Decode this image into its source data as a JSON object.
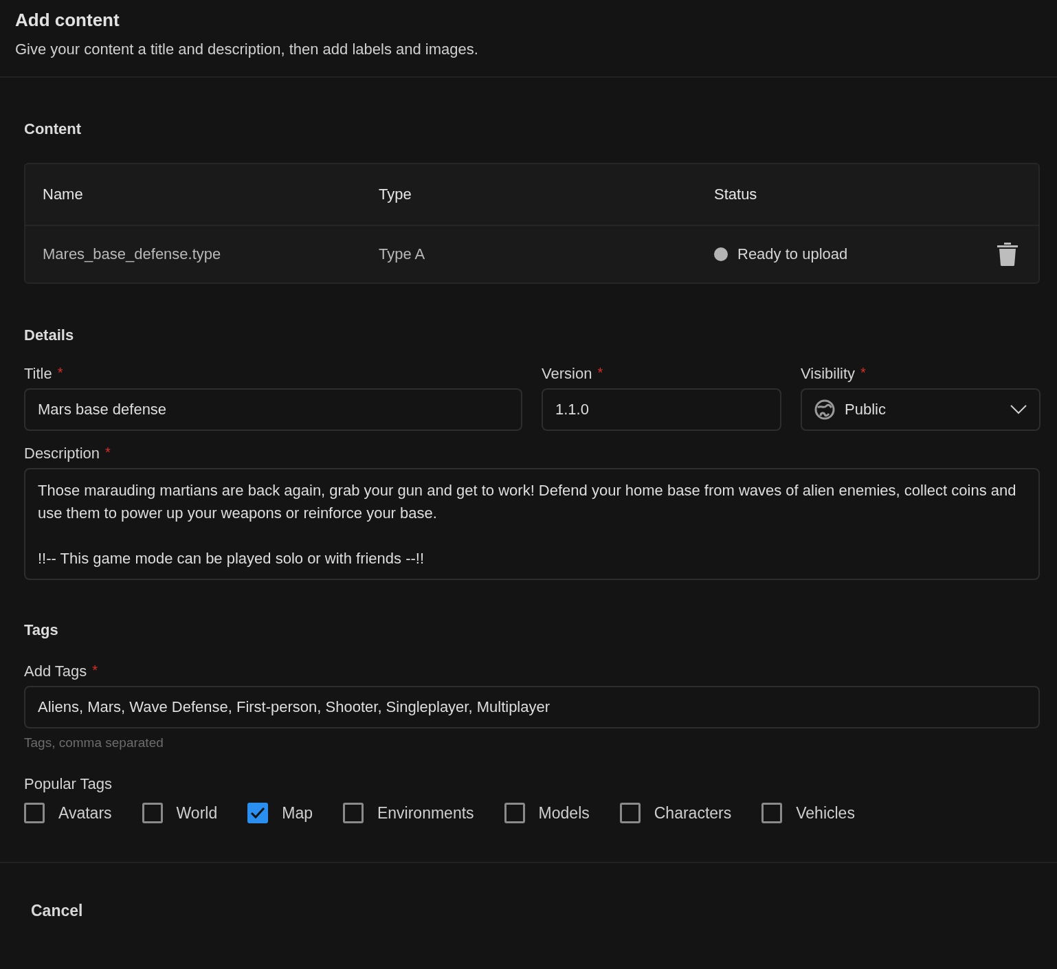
{
  "header": {
    "title": "Add content",
    "subtitle": "Give your content a title and description, then add labels and images."
  },
  "content": {
    "heading": "Content",
    "table": {
      "columns": [
        "Name",
        "Type",
        "Status"
      ],
      "rows": [
        {
          "name": "Mares_base_defense.type",
          "type": "Type A",
          "status": "Ready to upload"
        }
      ]
    }
  },
  "details": {
    "heading": "Details",
    "title_field": {
      "label": "Title",
      "required_mark": "*",
      "value": "Mars base defense"
    },
    "version_field": {
      "label": "Version",
      "required_mark": "*",
      "value": "1.1.0"
    },
    "visibility_field": {
      "label": "Visibility",
      "required_mark": "*",
      "value": "Public"
    },
    "description_field": {
      "label": "Description",
      "required_mark": "*",
      "value": "Those marauding martians are back again, grab your gun and get to work! Defend your home base from waves of alien enemies, collect coins and use them to power up your weapons or reinforce your base.\n\n!!-- This game mode can be played solo or with friends --!!"
    }
  },
  "tags": {
    "heading": "Tags",
    "add_tags": {
      "label": "Add Tags",
      "required_mark": "*",
      "value": "Aliens, Mars, Wave Defense, First-person, Shooter, Singleplayer, Multiplayer",
      "hint": "Tags, comma separated"
    },
    "popular_label": "Popular Tags",
    "popular": [
      {
        "label": "Avatars",
        "checked": false
      },
      {
        "label": "World",
        "checked": false
      },
      {
        "label": "Map",
        "checked": true
      },
      {
        "label": "Environments",
        "checked": false
      },
      {
        "label": "Models",
        "checked": false
      },
      {
        "label": "Characters",
        "checked": false
      },
      {
        "label": "Vehicles",
        "checked": false
      }
    ]
  },
  "footer": {
    "cancel": "Cancel"
  }
}
